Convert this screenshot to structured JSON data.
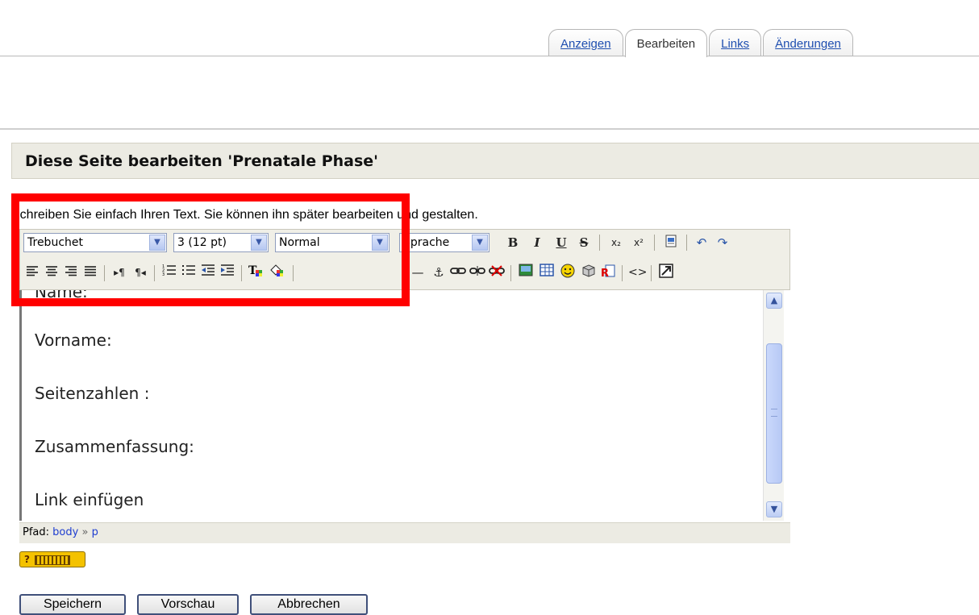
{
  "tabs": [
    {
      "label": "Anzeigen",
      "active": false
    },
    {
      "label": "Bearbeiten",
      "active": true
    },
    {
      "label": "Links",
      "active": false
    },
    {
      "label": "Änderungen",
      "active": false
    }
  ],
  "page": {
    "title": "Diese Seite bearbeiten 'Prenatale Phase'",
    "intro": "Schreiben Sie einfach Ihren Text. Sie können ihn später bearbeiten und gestalten."
  },
  "toolbar": {
    "font_family": "Trebuchet",
    "font_size": "3 (12 pt)",
    "paragraph_format": "Normal",
    "language": "Sprache",
    "bold": "B",
    "italic": "I",
    "underline": "U",
    "strikethrough": "S"
  },
  "content": {
    "lines": [
      "Name:",
      "Vorname:",
      "Seitenzahlen :",
      "Zusammenfassung:",
      "Link einfügen"
    ]
  },
  "path": {
    "label": "Pfad:",
    "items": [
      "body",
      "p"
    ],
    "separator": "»"
  },
  "help_badge": "?",
  "buttons": {
    "save": "Speichern",
    "preview": "Vorschau",
    "cancel": "Abbrechen"
  },
  "colors": {
    "highlight": "#ff0000",
    "link": "#1f4fb0",
    "heading_bg": "#ecebe3"
  }
}
